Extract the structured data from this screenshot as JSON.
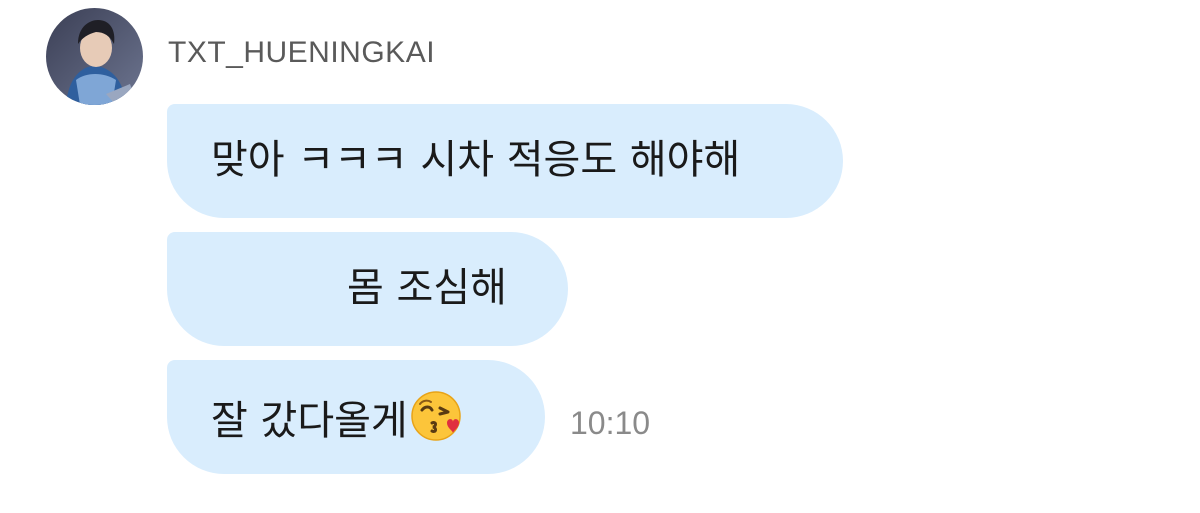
{
  "chat": {
    "sender": {
      "name": "TXT_HUENINGKAI",
      "avatar_icon": "profile-photo"
    },
    "messages": [
      {
        "text": "맞아 ㅋㅋㅋ 시차 적응도 해야해"
      },
      {
        "text": "몸 조심해"
      },
      {
        "text": "잘 갔다올게",
        "emoji": "face-blowing-a-kiss-icon"
      }
    ],
    "timestamp": "10:10"
  },
  "colors": {
    "bubble": "#d9edfd",
    "text": "#1a1a1a",
    "sender_name": "#5a5a5a",
    "timestamp": "#8a8a8a",
    "background": "#ffffff"
  }
}
